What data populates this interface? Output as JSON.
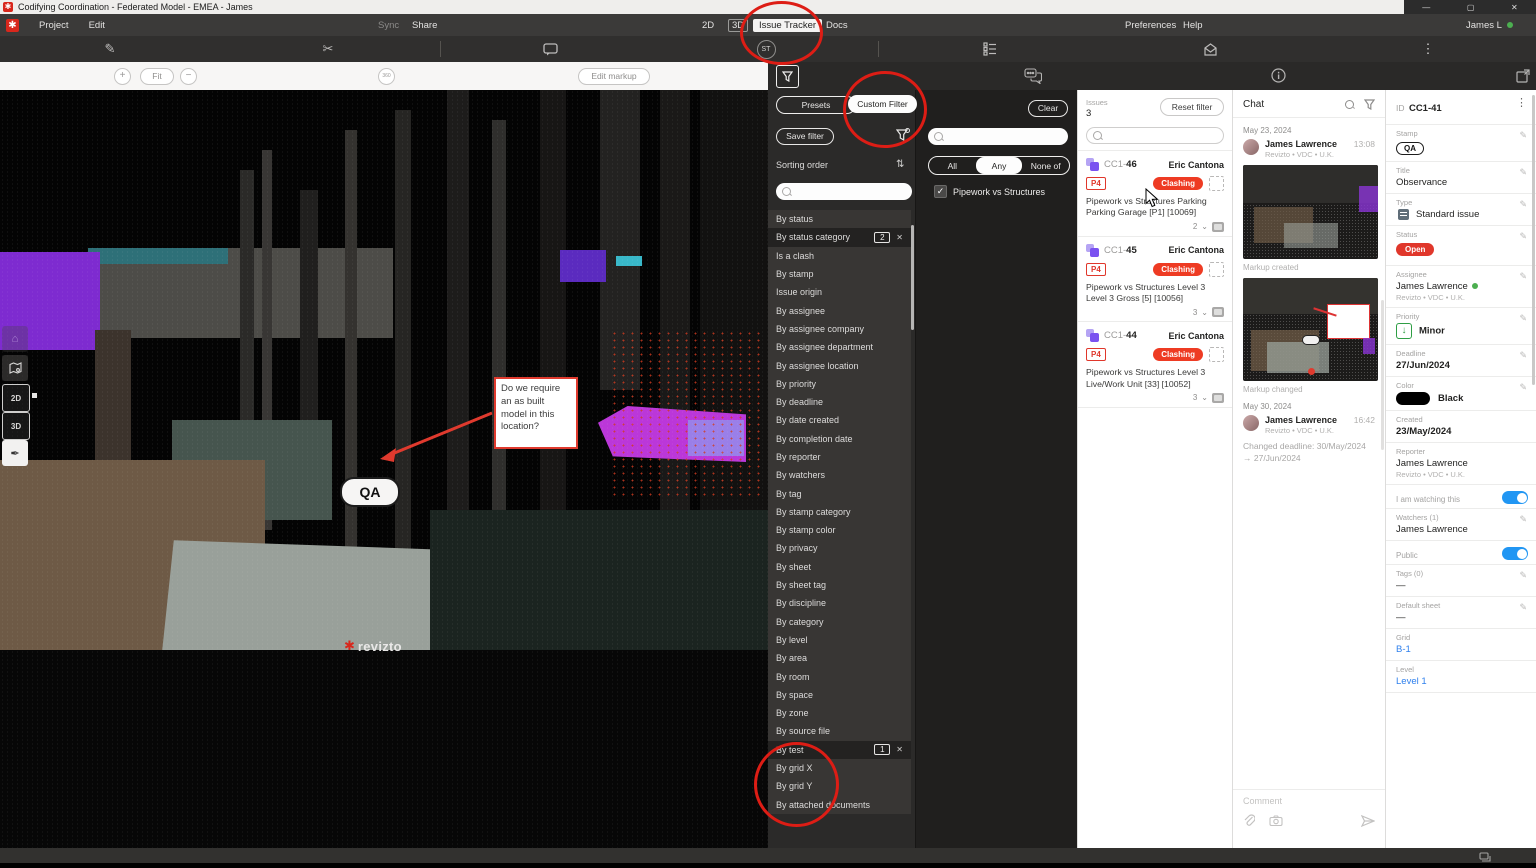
{
  "titlebar": {
    "title": "Codifying Coordination - Federated Model - EMEA - James",
    "minimize": "—",
    "maximize": "▢",
    "close": "✕"
  },
  "menubar": {
    "project": "Project",
    "edit": "Edit",
    "sync": "Sync",
    "share": "Share",
    "view_2d": "2D",
    "view_3d": "3D",
    "issue_tracker": "Issue Tracker",
    "docs": "Docs",
    "preferences": "Preferences",
    "help": "Help",
    "user": "James L"
  },
  "toolbar": {
    "st_badge": "ST"
  },
  "viewport": {
    "zoom_in": "+",
    "fit_label": "Fit",
    "zoom_out": "−",
    "pano_label": "360",
    "edit_markup_label": "Edit markup",
    "markup_note": "Do we require an as built model in this location?",
    "stamp": "QA",
    "watermark": "revizto",
    "tool_home": "⌂",
    "tool_2d": "2D",
    "tool_3d": "3D"
  },
  "filter_panel": {
    "tabs": {
      "presets": "Presets",
      "custom": "Custom Filter"
    },
    "save_filter": "Save filter",
    "sorting_order": "Sorting order",
    "items": [
      {
        "label": "By status"
      },
      {
        "label": "By status category",
        "count": "2"
      },
      {
        "label": "Is a clash"
      },
      {
        "label": "By stamp"
      },
      {
        "label": "Issue origin"
      },
      {
        "label": "By assignee"
      },
      {
        "label": "By assignee company"
      },
      {
        "label": "By assignee department"
      },
      {
        "label": "By assignee location"
      },
      {
        "label": "By priority"
      },
      {
        "label": "By deadline"
      },
      {
        "label": "By date created"
      },
      {
        "label": "By completion date"
      },
      {
        "label": "By reporter"
      },
      {
        "label": "By watchers"
      },
      {
        "label": "By tag"
      },
      {
        "label": "By stamp category"
      },
      {
        "label": "By stamp color"
      },
      {
        "label": "By privacy"
      },
      {
        "label": "By sheet"
      },
      {
        "label": "By sheet tag"
      },
      {
        "label": "By discipline"
      },
      {
        "label": "By category"
      },
      {
        "label": "By level"
      },
      {
        "label": "By area"
      },
      {
        "label": "By room"
      },
      {
        "label": "By space"
      },
      {
        "label": "By zone"
      },
      {
        "label": "By source file"
      },
      {
        "label": "By test",
        "count": "1"
      },
      {
        "label": "By grid X"
      },
      {
        "label": "By grid Y"
      },
      {
        "label": "By attached documents"
      }
    ]
  },
  "values_column": {
    "clear": "Clear",
    "segments": {
      "all": "All",
      "any": "Any",
      "none": "None of"
    },
    "checkbox_label": "Pipework vs Structures",
    "check": "✓"
  },
  "issues_panel": {
    "issues_label": "Issues",
    "count": "3",
    "reset_filter": "Reset filter",
    "issues": [
      {
        "id_prefix": "CC1-",
        "id_num": "46",
        "assignee": "Eric Cantona",
        "priority": "P4",
        "status": "Clashing",
        "title": "Pipework vs Structures Parking Parking Garage [P1] [10069]",
        "comments": "2"
      },
      {
        "id_prefix": "CC1-",
        "id_num": "45",
        "assignee": "Eric Cantona",
        "priority": "P4",
        "status": "Clashing",
        "title": "Pipework vs Structures Level 3 Level 3 Gross [5] [10056]",
        "comments": "3"
      },
      {
        "id_prefix": "CC1-",
        "id_num": "44",
        "assignee": "Eric Cantona",
        "priority": "P4",
        "status": "Clashing",
        "title": "Pipework vs Structures Level 3 Live/Work Unit [33] [10052]",
        "comments": "3"
      }
    ]
  },
  "chat_panel": {
    "title": "Chat",
    "date1": "May 23, 2024",
    "msg1": {
      "author": "James Lawrence",
      "time": "13:08",
      "org": "Revizto • VDC • U.K."
    },
    "markup_created": "Markup created",
    "markup_changed": "Markup changed",
    "date2": "May 30, 2024",
    "msg2": {
      "author": "James Lawrence",
      "time": "16:42",
      "org": "Revizto • VDC • U.K.",
      "body": "Changed deadline: 30/May/2024 → 27/Jun/2024"
    },
    "comment_placeholder": "Comment"
  },
  "details_panel": {
    "id_label": "ID",
    "id_value": "CC1-41",
    "stamp": {
      "label": "Stamp",
      "value": "QA"
    },
    "title": {
      "label": "Title",
      "value": "Observance"
    },
    "type": {
      "label": "Type",
      "value": "Standard issue"
    },
    "status": {
      "label": "Status",
      "value": "Open"
    },
    "assignee": {
      "label": "Assignee",
      "value": "James Lawrence",
      "org": "Revizto • VDC • U.K."
    },
    "priority": {
      "label": "Priority",
      "value": "Minor",
      "arrow": "↓"
    },
    "deadline": {
      "label": "Deadline",
      "value": "27/Jun/2024"
    },
    "color": {
      "label": "Color",
      "value": "Black",
      "hex": "#000000"
    },
    "created": {
      "label": "Created",
      "value": "23/May/2024"
    },
    "reporter": {
      "label": "Reporter",
      "value": "James Lawrence",
      "org": "Revizto • VDC • U.K."
    },
    "watching": {
      "label": "I am watching this",
      "on": true
    },
    "watchers": {
      "label": "Watchers (1)",
      "value": "James Lawrence"
    },
    "public": {
      "label": "Public",
      "on": true
    },
    "tags": {
      "label": "Tags (0)",
      "value": "—"
    },
    "default_sheet": {
      "label": "Default sheet",
      "value": "—"
    },
    "grid": {
      "label": "Grid",
      "value": "B-1"
    },
    "level": {
      "label": "Level",
      "value": "Level 1"
    }
  },
  "colors": {
    "accent-red": "#e0372b",
    "annotation-red": "#dd1d15",
    "toggle-blue": "#2196f3",
    "link-blue": "#2f80ed",
    "online-green": "#4caf50",
    "priority-green": "#2e9e44",
    "purple-icon": "#7a52f0",
    "brand-red": "#d8271c"
  }
}
